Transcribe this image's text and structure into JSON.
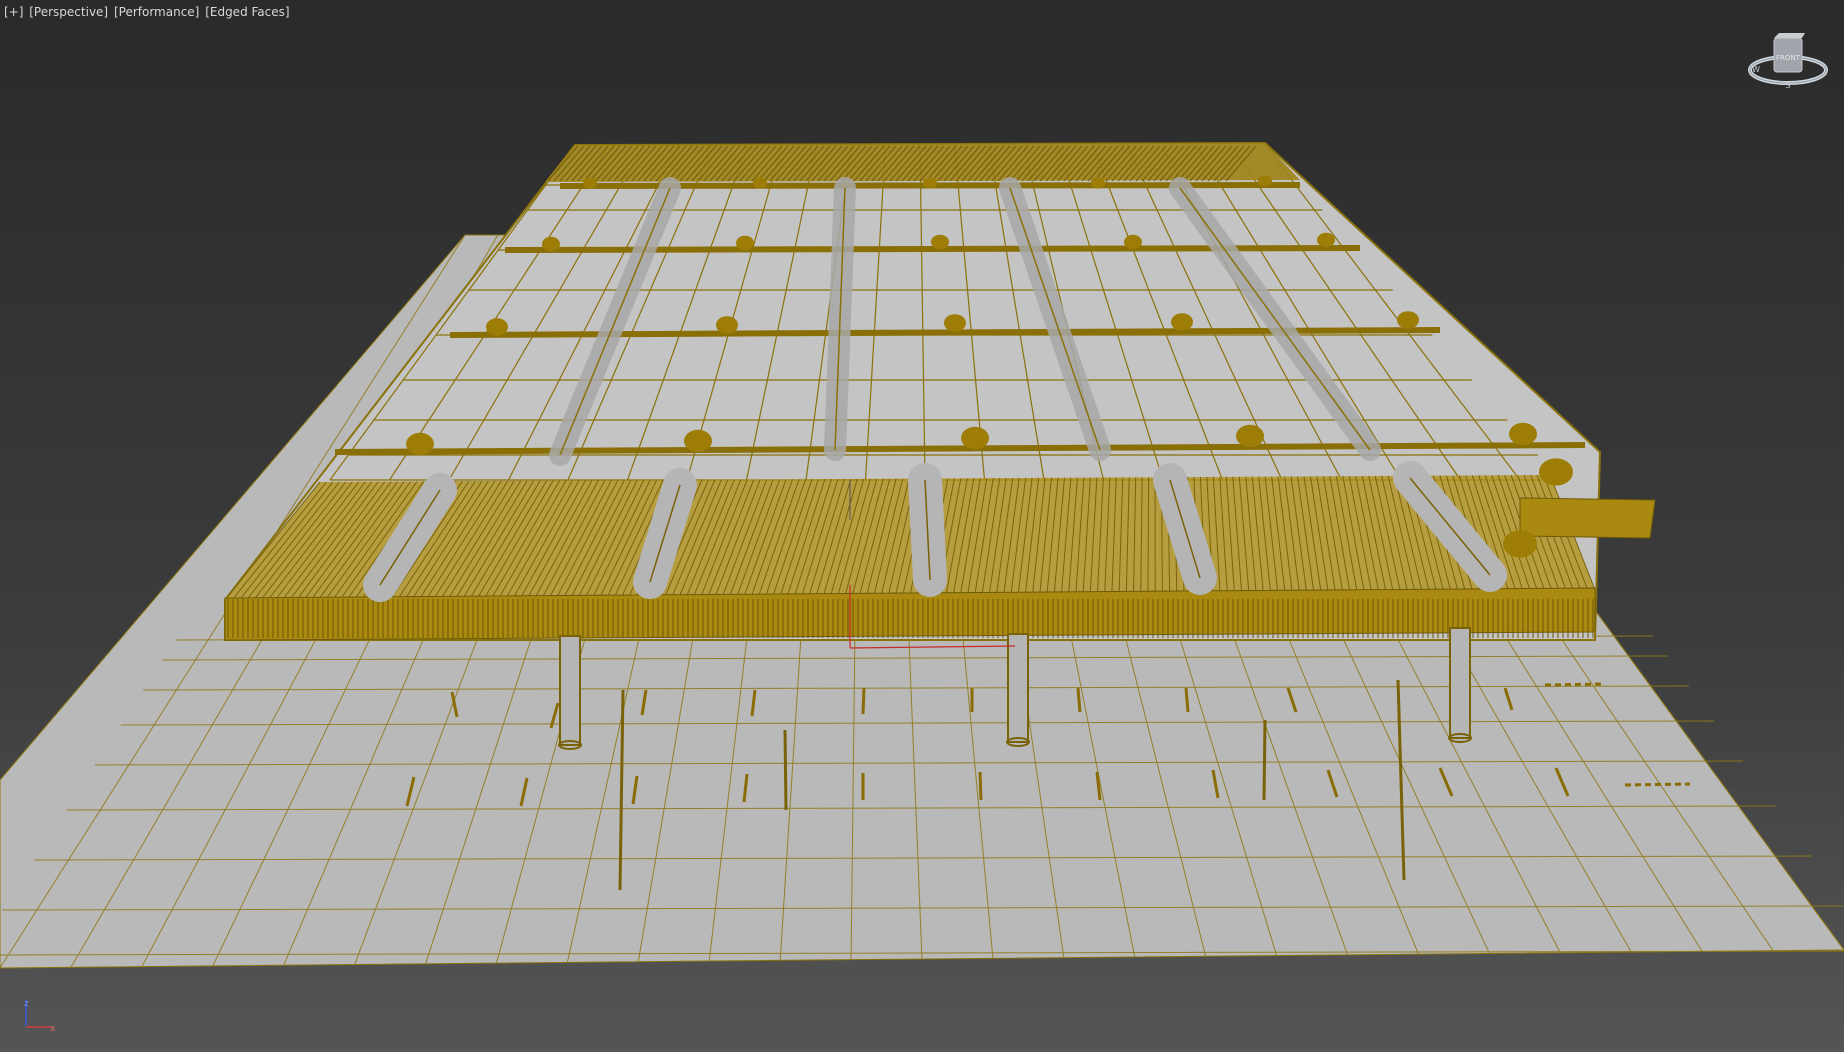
{
  "viewport": {
    "label_parts": [
      "[+]",
      "[Perspective]",
      "[Performance]",
      "[Edged Faces]"
    ]
  },
  "viewcube": {
    "face_label": "FRONT"
  },
  "axis_tripod": {
    "x_label": "x",
    "z_label": "z"
  },
  "colors": {
    "background_top": "#2a2a2a",
    "wire": "#9a7d0b",
    "ground": "#b9b9b9",
    "roof_panel": "#c2c2c2",
    "pivot_red": "#c62a2a"
  },
  "scene": {
    "object": "parking-canopy wireframe model",
    "display_mode": "Edged Faces"
  }
}
